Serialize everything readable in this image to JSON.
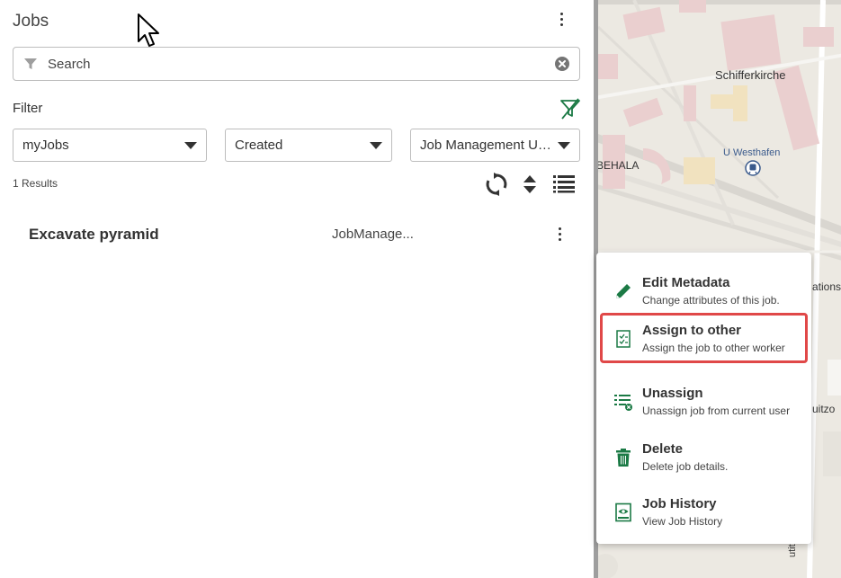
{
  "panel": {
    "title": "Jobs",
    "search": {
      "placeholder": "Search",
      "value": ""
    },
    "filter_label": "Filter",
    "filters": [
      {
        "value": "myJobs"
      },
      {
        "value": "Created"
      },
      {
        "value": "Job Management Us..."
      }
    ],
    "results_count": "1 Results",
    "jobs": [
      {
        "name": "Excavate pyramid",
        "assignee": "JobManage..."
      }
    ]
  },
  "map": {
    "labels": {
      "church": "Schifferkirche",
      "station": "U Westhafen",
      "street_left": "BEHALA",
      "edge_right": "ations",
      "edge_right2": "uitzo",
      "vertical_street": "utitz"
    }
  },
  "context_menu": {
    "items": [
      {
        "title": "Edit Metadata",
        "subtitle": "Change attributes of this job.",
        "icon": "pencil-icon"
      },
      {
        "title": "Assign to other",
        "subtitle": "Assign the job to other worker",
        "icon": "assign-document-icon"
      },
      {
        "title": "Unassign",
        "subtitle": "Unassign job from current user",
        "icon": "unassign-list-icon"
      },
      {
        "title": "Delete",
        "subtitle": "Delete job details.",
        "icon": "trash-icon"
      },
      {
        "title": "Job History",
        "subtitle": "View Job History",
        "icon": "history-icon"
      }
    ]
  },
  "colors": {
    "accent_green": "#1b7a45",
    "highlight_red": "#e04848",
    "splitter": "#9e9e9e",
    "map_background": "#ece9e2"
  }
}
